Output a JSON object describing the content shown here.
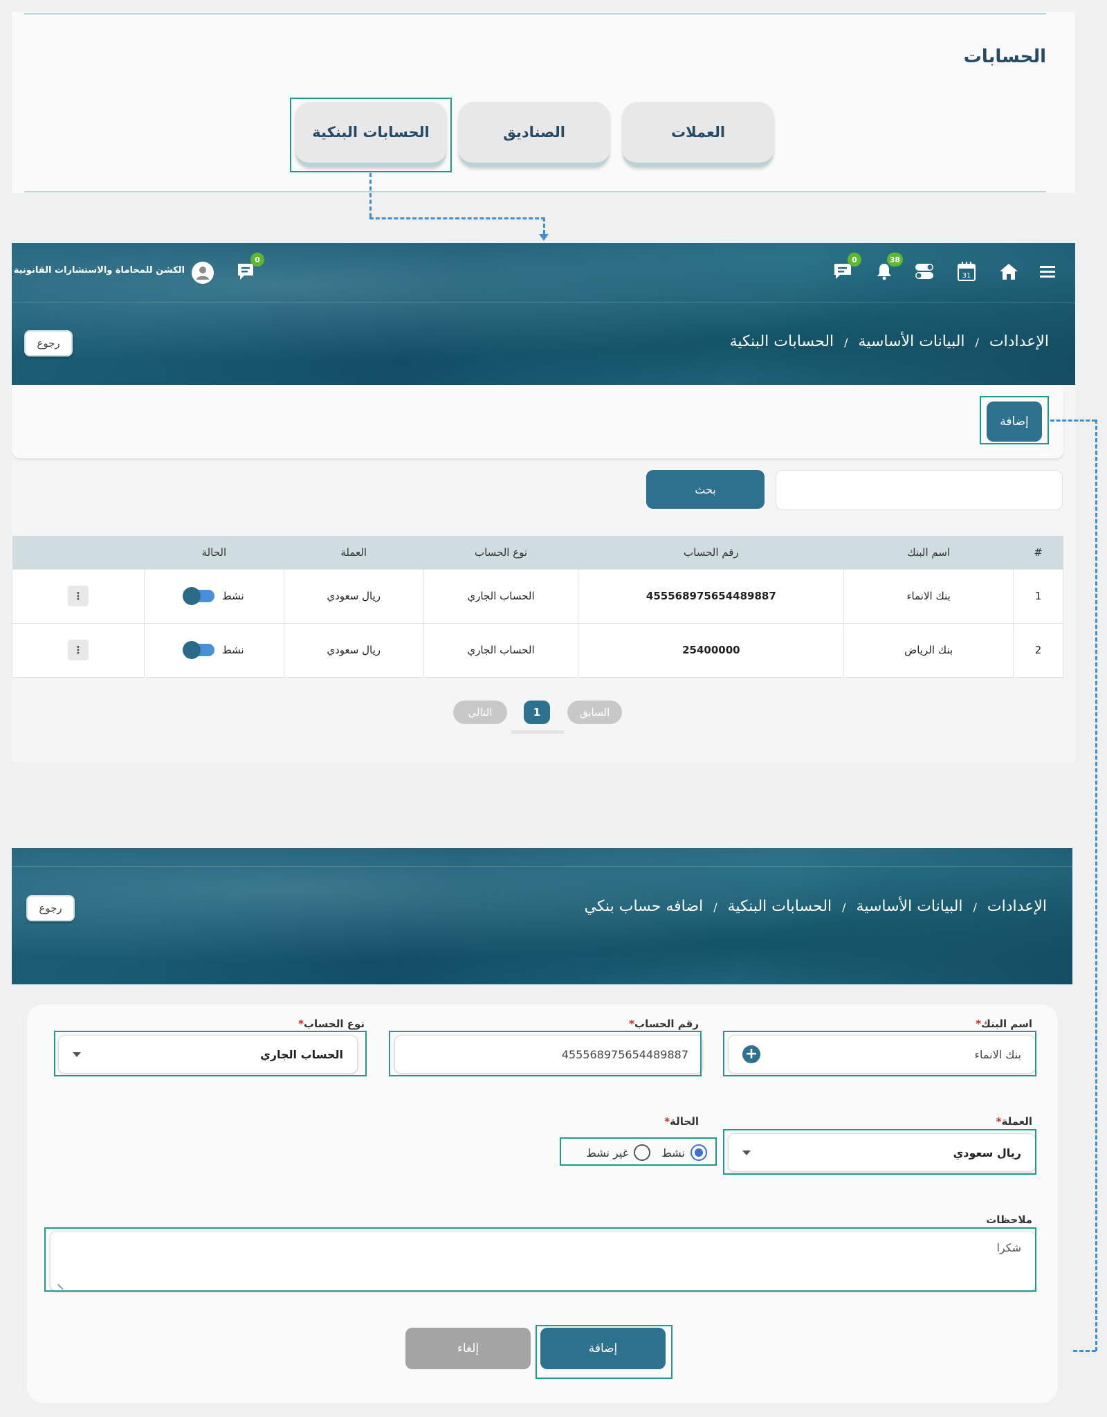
{
  "colors": {
    "accent": "#2e718e",
    "connector": "#3a8fd6",
    "highlight": "#1f9a8c",
    "badge": "#5cb82e",
    "required": "#d62828"
  },
  "tabs_panel": {
    "title": "الحسابات",
    "tabs": [
      {
        "label": "العملات"
      },
      {
        "label": "الصناديق"
      },
      {
        "label": "الحسابات البنكية",
        "selected": true
      }
    ]
  },
  "topbar": {
    "company_name": "الكشن للمحاماة والاستشارات القانونية",
    "icons": [
      {
        "name": "menu-icon"
      },
      {
        "name": "home-icon"
      },
      {
        "name": "calendar-icon",
        "text": "31"
      },
      {
        "name": "toggle-icon"
      },
      {
        "name": "bell-icon",
        "badge": "38"
      },
      {
        "name": "chat-icon",
        "badge": "0"
      }
    ],
    "messages_badge": "0"
  },
  "list_screen": {
    "breadcrumb": [
      "الإعدادات",
      "البيانات الأساسية",
      "الحسابات البنكية"
    ],
    "separator": "/",
    "back_label": "رجوع",
    "add_label": "إضافة",
    "search": {
      "button_label": "بحث",
      "placeholder": ""
    },
    "table": {
      "headers": [
        "#",
        "اسم البنك",
        "رقم الحساب",
        "نوع الحساب",
        "العملة",
        "الحالة",
        ""
      ],
      "rows": [
        {
          "index": "1",
          "bank": "بنك الانماء",
          "account_no": "455568975654489887",
          "type": "الحساب الجاري",
          "currency": "ريال سعودي",
          "status": "نشط"
        },
        {
          "index": "2",
          "bank": "بنك الرياض",
          "account_no": "25400000",
          "type": "الحساب الجاري",
          "currency": "ريال سعودي",
          "status": "نشط"
        }
      ],
      "kebab": "⋮"
    },
    "pagination": {
      "prev": "السابق",
      "current": "1",
      "next": "التالي"
    }
  },
  "add_screen": {
    "breadcrumb": [
      "الإعدادات",
      "البيانات الأساسية",
      "الحسابات البنكية",
      "اضافه حساب بنكي"
    ],
    "back_label": "رجوع",
    "fields": {
      "bank_name": {
        "label": "اسم البنك",
        "value": "بنك الانماء"
      },
      "account_no": {
        "label": "رقم الحساب",
        "value": "455568975654489887"
      },
      "account_type": {
        "label": "نوع الحساب",
        "value": "الحساب الجاري"
      },
      "currency": {
        "label": "العملة",
        "value": "ريال سعودي"
      },
      "status": {
        "label": "الحالة",
        "options": [
          "نشط",
          "غير نشط"
        ],
        "selected": "نشط"
      },
      "notes": {
        "label": "ملاحظات",
        "value": "شكرا"
      }
    },
    "required_mark": "*",
    "submit_label": "إضافة",
    "cancel_label": "إلغاء"
  }
}
